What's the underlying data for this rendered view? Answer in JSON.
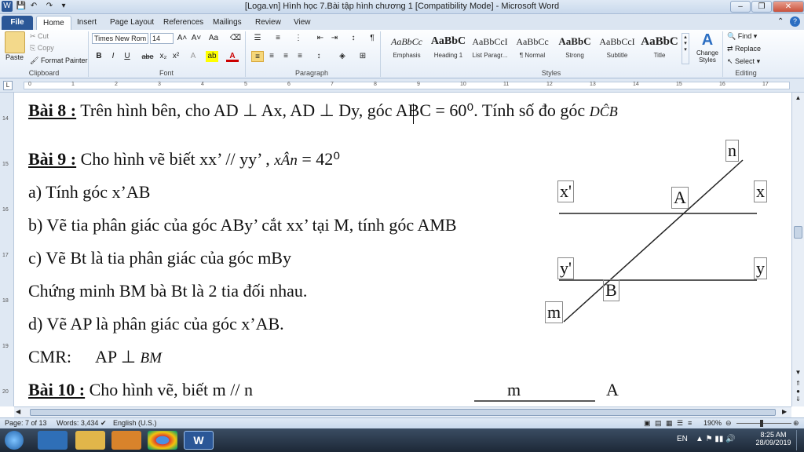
{
  "window": {
    "title": "[Loga.vn] Hình học 7.Bài tập hình chương 1 [Compatibility Mode]  -  Microsoft Word",
    "app_icon": "W"
  },
  "tabs": [
    "File",
    "Home",
    "Insert",
    "Page Layout",
    "References",
    "Mailings",
    "Review",
    "View"
  ],
  "clipboard": {
    "paste": "Paste",
    "cut": "Cut",
    "copy": "Copy",
    "format_painter": "Format Painter",
    "label": "Clipboard"
  },
  "font": {
    "name": "Times New Rom",
    "size": "14",
    "label": "Font",
    "bold": "B",
    "italic": "I",
    "underline": "U",
    "strike": "abe",
    "sub": "x₂",
    "sup": "x²"
  },
  "paragraph": {
    "label": "Paragraph"
  },
  "styles": {
    "label": "Styles",
    "items": [
      {
        "preview": "AaBbCc",
        "name": "Emphasis"
      },
      {
        "preview": "AaBbC",
        "name": "Heading 1"
      },
      {
        "preview": "AaBbCcI",
        "name": "List Paragr..."
      },
      {
        "preview": "AaBbCc",
        "name": "¶ Normal"
      },
      {
        "preview": "AaBbC",
        "name": "Strong"
      },
      {
        "preview": "AaBbCcI",
        "name": "Subtitle"
      },
      {
        "preview": "AaBbC",
        "name": "Title"
      }
    ],
    "change_styles": "Change Styles"
  },
  "editing": {
    "find": "Find",
    "replace": "Replace",
    "select": "Select",
    "label": "Editing"
  },
  "document": {
    "bai8_title": "Bài 8 :",
    "bai8_text": " Trên hình bên, cho AD ⊥ Ax, AD ⊥ Dy, góc ABC = 60⁰. Tính số đo góc ",
    "bai8_angle": "DĈB",
    "bai9_title": "Bài 9 :",
    "bai9_text": " Cho hình vẽ biết xx’ // yy’ , ",
    "bai9_angle": "xÂn",
    "bai9_value": " = 42⁰",
    "line_a": "a) Tính góc x’AB",
    "line_b": "b) Vẽ tia phân giác của góc  ABy’ cắt xx’ tại M, tính góc AMB",
    "line_c": "c) Vẽ Bt là tia phân giác của góc mBy",
    "line_cm": "Chứng minh BM bà Bt là 2 tia đối nhau.",
    "line_d": "d) Vẽ AP là phân giác của góc x’AB.",
    "line_cmr_label": "CMR:",
    "line_cmr_expr": "AP ⊥ ",
    "line_cmr_bm": "BM",
    "bai10_title": "Bài 10 :",
    "bai10_text": " Cho hình vẽ, biết m // n",
    "fig_labels": {
      "n": "n",
      "x_prime": "x'",
      "A": "A",
      "x": "x",
      "y_prime": "y'",
      "y": "y",
      "B": "B",
      "m": "m",
      "m2": "m",
      "A2": "A"
    }
  },
  "status": {
    "page": "Page: 7 of 13",
    "words": "Words: 3,434",
    "language": "English (U.S.)",
    "zoom": "190%"
  },
  "taskbar": {
    "lang": "EN",
    "time": "8:25 AM",
    "date": "28/09/2019"
  }
}
